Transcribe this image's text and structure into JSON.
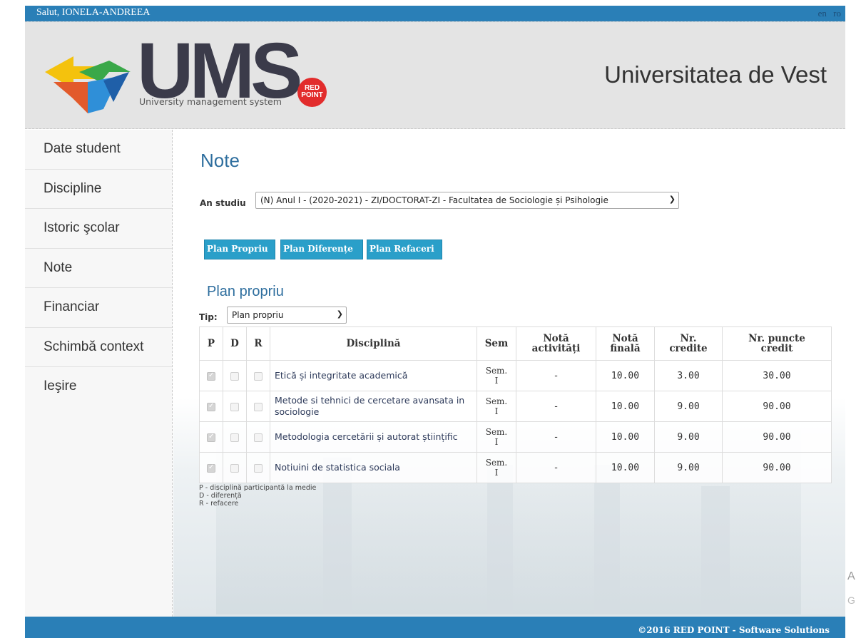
{
  "topbar": {
    "greeting": "Salut, IONELA-ANDREEA",
    "lang_en": "en",
    "lang_ro": "ro"
  },
  "header": {
    "logo_text": "UMS",
    "logo_subtitle": "University management system",
    "badge_line1": "RED",
    "badge_line2": "POINT",
    "university": "Universitatea de Vest"
  },
  "sidebar": {
    "items": [
      {
        "label": "Date student"
      },
      {
        "label": "Discipline"
      },
      {
        "label": "Istoric şcolar"
      },
      {
        "label": "Note"
      },
      {
        "label": "Financiar"
      },
      {
        "label": "Schimbă context"
      },
      {
        "label": "Ieşire"
      }
    ]
  },
  "main": {
    "title": "Note",
    "an_studiu_label": "An studiu",
    "an_studiu_value": "(N) Anul I - (2020-2021) - ZI/DOCTORAT-ZI - Facultatea de Sociologie și Psihologie",
    "buttons": {
      "plan_propriu": "Plan Propriu",
      "plan_diferente": "Plan Diferențe",
      "plan_refaceri": "Plan Refaceri"
    },
    "section_title": "Plan propriu",
    "tip_label": "Tip:",
    "tip_value": "Plan propriu",
    "table": {
      "headers": {
        "p": "P",
        "d": "D",
        "r": "R",
        "disciplina": "Disciplină",
        "sem": "Sem",
        "nota_act_1": "Notă",
        "nota_act_2": "activități",
        "nota_fin_1": "Notă",
        "nota_fin_2": "finală",
        "credite_1": "Nr.",
        "credite_2": "credite",
        "puncte_1": "Nr. puncte",
        "puncte_2": "credit"
      },
      "rows": [
        {
          "p": true,
          "d": false,
          "r": false,
          "disciplina": "Etică și integritate academică",
          "sem_1": "Sem.",
          "sem_2": "I",
          "nota_activitati": "-",
          "nota_finala": "10.00",
          "credite": "3.00",
          "puncte": "30.00"
        },
        {
          "p": true,
          "d": false,
          "r": false,
          "disciplina": "Metode si tehnici de cercetare avansata in sociologie",
          "sem_1": "Sem.",
          "sem_2": "I",
          "nota_activitati": "-",
          "nota_finala": "10.00",
          "credite": "9.00",
          "puncte": "90.00"
        },
        {
          "p": true,
          "d": false,
          "r": false,
          "disciplina": "Metodologia cercetării și autorat științific",
          "sem_1": "Sem.",
          "sem_2": "I",
          "nota_activitati": "-",
          "nota_finala": "10.00",
          "credite": "9.00",
          "puncte": "90.00"
        },
        {
          "p": true,
          "d": false,
          "r": false,
          "disciplina": "Notiuini de statistica sociala",
          "sem_1": "Sem.",
          "sem_2": "I",
          "nota_activitati": "-",
          "nota_finala": "10.00",
          "credite": "9.00",
          "puncte": "90.00"
        }
      ]
    },
    "legend": [
      "P - disciplină participantă la medie",
      "D - diferență",
      "R - refacere"
    ]
  },
  "footer": {
    "copyright": "©2016 RED POINT - Software Solutions"
  },
  "edge": {
    "a": "A",
    "g": "G"
  },
  "colors": {
    "accent": "#2a7fb7",
    "button": "#2a9fc9",
    "title": "#2e6e9e"
  }
}
